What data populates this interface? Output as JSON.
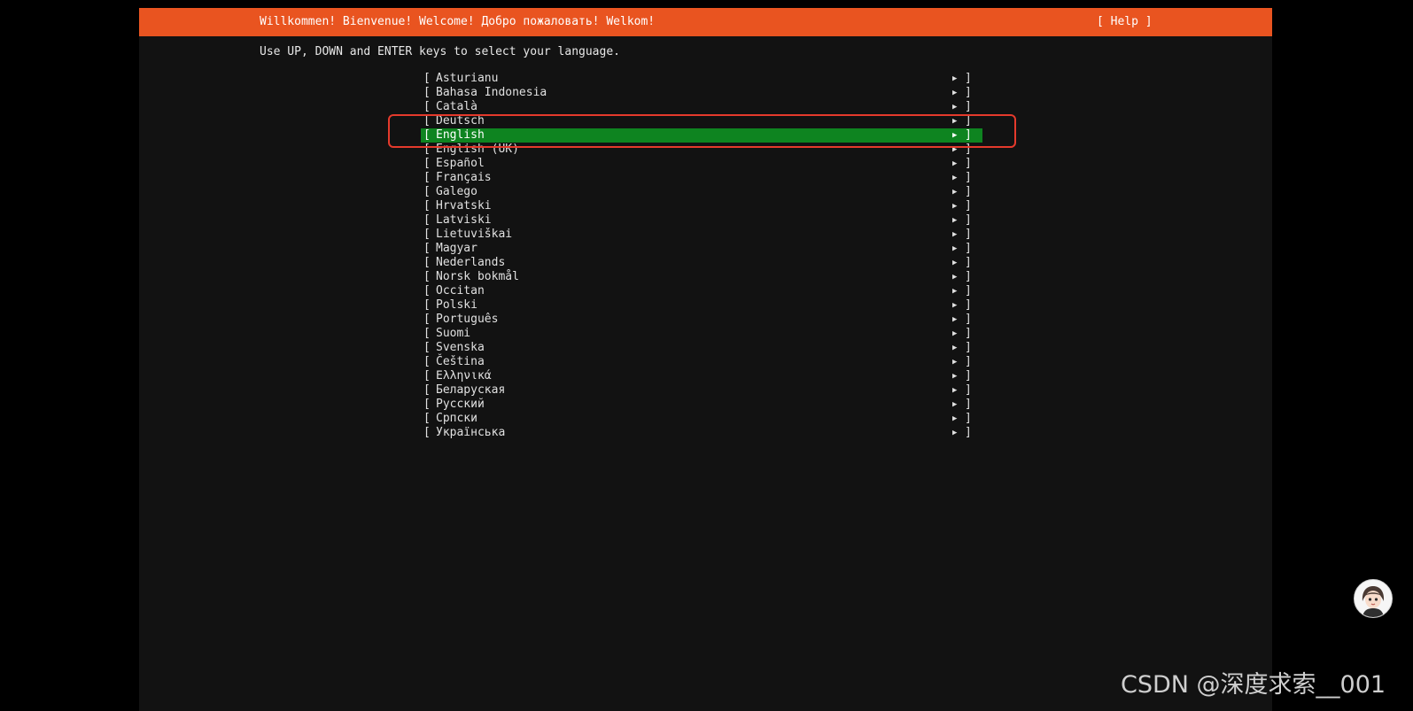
{
  "header": {
    "title": "Willkommen! Bienvenue! Welcome! Добро пожаловать! Welkom!",
    "help_label": "[ Help ]"
  },
  "instruction": "Use UP, DOWN and ENTER keys to select your language.",
  "brackets": {
    "left": "[",
    "right": "]",
    "arrow": "▶"
  },
  "languages": [
    {
      "label": "Asturianu"
    },
    {
      "label": "Bahasa Indonesia"
    },
    {
      "label": "Català"
    },
    {
      "label": "Deutsch"
    },
    {
      "label": "English",
      "selected": true
    },
    {
      "label": "English (UK)"
    },
    {
      "label": "Español"
    },
    {
      "label": "Français"
    },
    {
      "label": "Galego"
    },
    {
      "label": "Hrvatski"
    },
    {
      "label": "Latviski"
    },
    {
      "label": "Lietuviškai"
    },
    {
      "label": "Magyar"
    },
    {
      "label": "Nederlands"
    },
    {
      "label": "Norsk bokmål"
    },
    {
      "label": "Occitan"
    },
    {
      "label": "Polski"
    },
    {
      "label": "Português"
    },
    {
      "label": "Suomi"
    },
    {
      "label": "Svenska"
    },
    {
      "label": "Čeština"
    },
    {
      "label": "Ελληνικά"
    },
    {
      "label": "Беларуская"
    },
    {
      "label": "Русский"
    },
    {
      "label": "Српски"
    },
    {
      "label": "Українська"
    }
  ],
  "watermark": "CSDN @深度求索__001",
  "colors": {
    "header_bg": "#e95420",
    "selected_bg": "#0e8420",
    "screen_bg": "#121212",
    "highlight_border": "#e53a2c"
  },
  "icons": {
    "arrow": "right-triangle-icon",
    "avatar": "user-avatar-icon"
  }
}
